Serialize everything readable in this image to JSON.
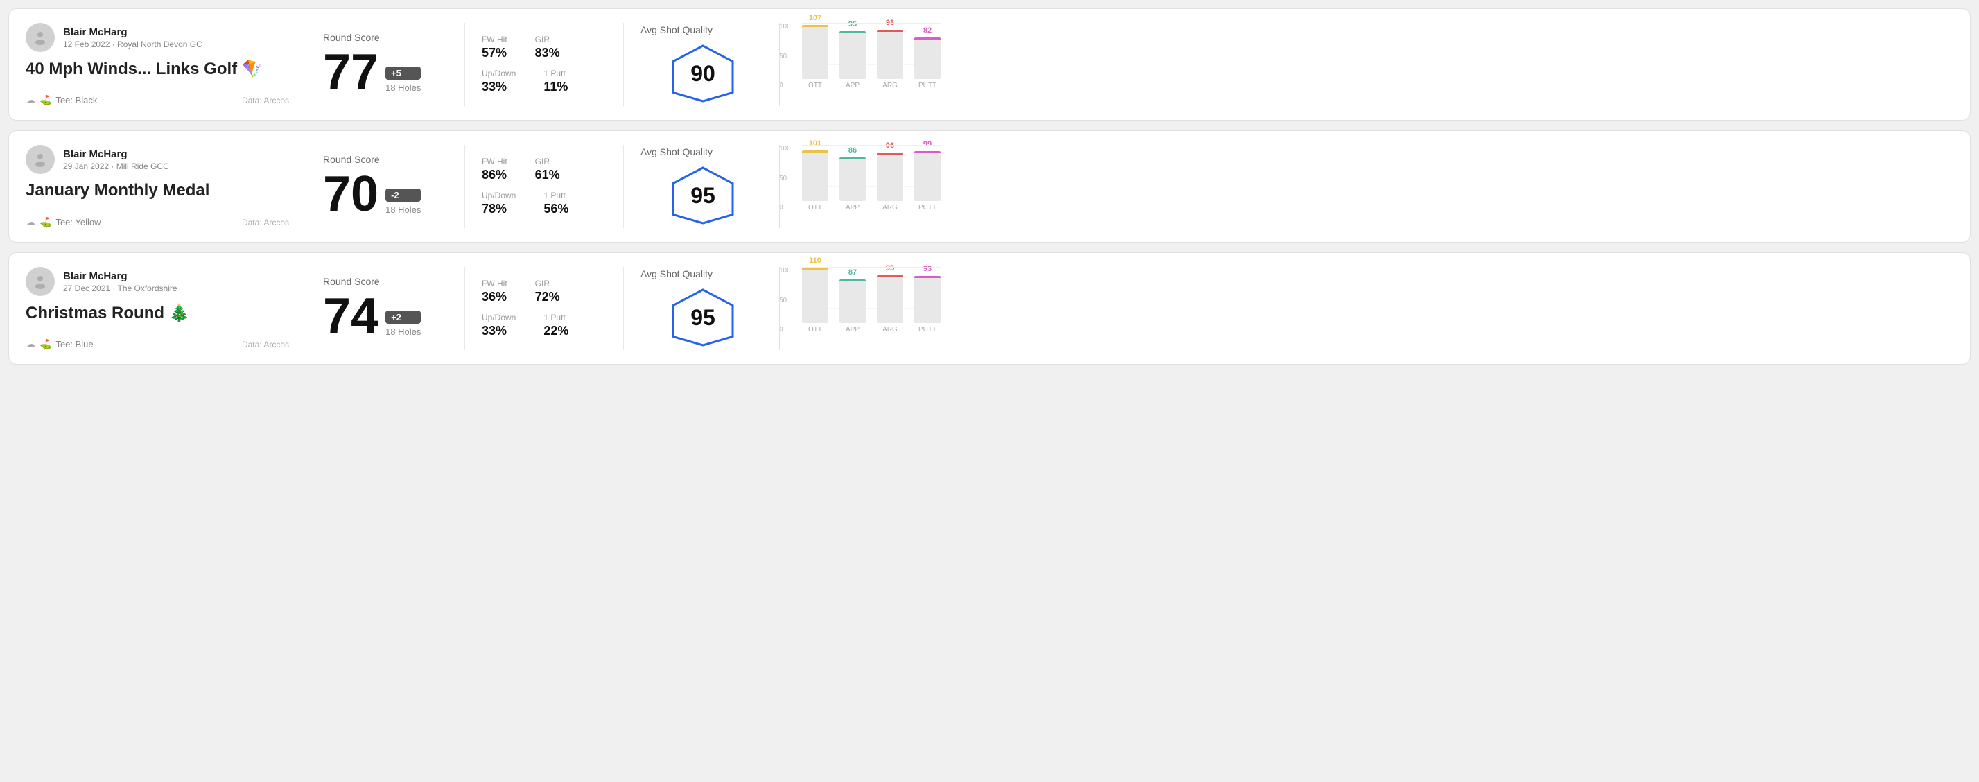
{
  "rounds": [
    {
      "id": "round1",
      "user": {
        "name": "Blair McHarg",
        "date_course": "12 Feb 2022 · Royal North Devon GC"
      },
      "title": "40 Mph Winds... Links Golf 🪁",
      "tee": "Black",
      "data_source": "Data: Arccos",
      "score": {
        "value": "77",
        "badge": "+5",
        "badge_type": "positive",
        "holes": "18 Holes"
      },
      "stats": {
        "fw_hit_label": "FW Hit",
        "fw_hit_value": "57%",
        "gir_label": "GIR",
        "gir_value": "83%",
        "updown_label": "Up/Down",
        "updown_value": "33%",
        "oneputt_label": "1 Putt",
        "oneputt_value": "11%"
      },
      "quality": {
        "label": "Avg Shot Quality",
        "score": "90"
      },
      "chart": {
        "bars": [
          {
            "label": "OTT",
            "value": 107,
            "color": "#e8c44a"
          },
          {
            "label": "APP",
            "value": 95,
            "color": "#4db89e"
          },
          {
            "label": "ARG",
            "value": 98,
            "color": "#e05a5a"
          },
          {
            "label": "PUTT",
            "value": 82,
            "color": "#d95ec4"
          }
        ],
        "y_max": 100,
        "y_labels": [
          "100",
          "50",
          "0"
        ]
      }
    },
    {
      "id": "round2",
      "user": {
        "name": "Blair McHarg",
        "date_course": "29 Jan 2022 · Mill Ride GCC"
      },
      "title": "January Monthly Medal",
      "tee": "Yellow",
      "data_source": "Data: Arccos",
      "score": {
        "value": "70",
        "badge": "-2",
        "badge_type": "negative",
        "holes": "18 Holes"
      },
      "stats": {
        "fw_hit_label": "FW Hit",
        "fw_hit_value": "86%",
        "gir_label": "GIR",
        "gir_value": "61%",
        "updown_label": "Up/Down",
        "updown_value": "78%",
        "oneputt_label": "1 Putt",
        "oneputt_value": "56%"
      },
      "quality": {
        "label": "Avg Shot Quality",
        "score": "95"
      },
      "chart": {
        "bars": [
          {
            "label": "OTT",
            "value": 101,
            "color": "#e8c44a"
          },
          {
            "label": "APP",
            "value": 86,
            "color": "#4db89e"
          },
          {
            "label": "ARG",
            "value": 96,
            "color": "#e05a5a"
          },
          {
            "label": "PUTT",
            "value": 99,
            "color": "#d95ec4"
          }
        ],
        "y_max": 100,
        "y_labels": [
          "100",
          "50",
          "0"
        ]
      }
    },
    {
      "id": "round3",
      "user": {
        "name": "Blair McHarg",
        "date_course": "27 Dec 2021 · The Oxfordshire"
      },
      "title": "Christmas Round 🎄",
      "tee": "Blue",
      "data_source": "Data: Arccos",
      "score": {
        "value": "74",
        "badge": "+2",
        "badge_type": "positive",
        "holes": "18 Holes"
      },
      "stats": {
        "fw_hit_label": "FW Hit",
        "fw_hit_value": "36%",
        "gir_label": "GIR",
        "gir_value": "72%",
        "updown_label": "Up/Down",
        "updown_value": "33%",
        "oneputt_label": "1 Putt",
        "oneputt_value": "22%"
      },
      "quality": {
        "label": "Avg Shot Quality",
        "score": "95"
      },
      "chart": {
        "bars": [
          {
            "label": "OTT",
            "value": 110,
            "color": "#e8c44a"
          },
          {
            "label": "APP",
            "value": 87,
            "color": "#4db89e"
          },
          {
            "label": "ARG",
            "value": 95,
            "color": "#e05a5a"
          },
          {
            "label": "PUTT",
            "value": 93,
            "color": "#d95ec4"
          }
        ],
        "y_max": 100,
        "y_labels": [
          "100",
          "50",
          "0"
        ]
      }
    }
  ]
}
